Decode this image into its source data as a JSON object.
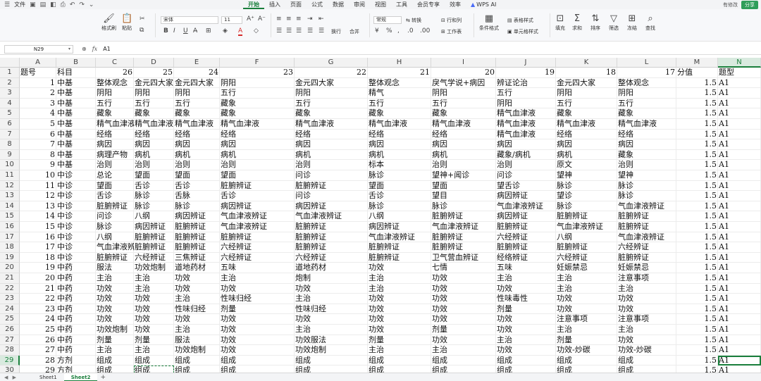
{
  "titlebar": {
    "file_label": "文件",
    "menus": [
      "开始",
      "插入",
      "页面",
      "公式",
      "数据",
      "审阅",
      "视图",
      "工具",
      "会员专享",
      "效率"
    ],
    "active_menu": "开始",
    "wps_ai_label": "WPS AI",
    "modified_label": "有修改",
    "share_label": "分享"
  },
  "ribbon": {
    "format_painter": "格式刷",
    "paste": "粘贴",
    "font_name": "宋体",
    "font_size": "11",
    "number_format": "常规",
    "convert": "转换",
    "wrap": "换行",
    "merge": "合并",
    "rows_cols": "行和列",
    "worksheet": "工作表",
    "cond_format": "条件格式",
    "table_style": "表格样式",
    "cell_style": "单元格样式",
    "fill": "填充",
    "sum": "求和",
    "sort": "排序",
    "filter": "筛选",
    "freeze": "冻结",
    "find": "查找",
    "font_color": "#d62b2b",
    "highlight_color": "#f5d200"
  },
  "formula_bar": {
    "name_box": "N29",
    "fx_label": "fx",
    "value": "A1"
  },
  "grid": {
    "columns": [
      "A",
      "B",
      "C",
      "D",
      "E",
      "F",
      "G",
      "H",
      "I",
      "J",
      "K",
      "L",
      "M",
      "N"
    ],
    "selected_column": "N",
    "row_numbers": [
      1,
      2,
      3,
      4,
      5,
      6,
      7,
      8,
      9,
      10,
      11,
      12,
      13,
      14,
      15,
      16,
      17,
      18,
      19,
      20,
      21,
      22,
      23,
      24,
      25,
      26,
      27,
      28,
      29,
      30
    ],
    "selected_row": 29,
    "header_row": [
      "题号",
      "科目",
      "26",
      "25",
      "24",
      "23",
      "22",
      "21",
      "20",
      "19",
      "18",
      "17",
      "分值",
      "题型"
    ],
    "rows": [
      [
        "1",
        "中基",
        "整体观念",
        "金元四大家",
        "金元四大家",
        "阴阳",
        "金元四大家",
        "整体观念",
        "戾气学说+病因",
        "辨证论治",
        "金元四大家",
        "整体观念",
        "1.5",
        "A1"
      ],
      [
        "2",
        "中基",
        "阴阳",
        "阴阳",
        "阴阳",
        "五行",
        "阴阳",
        "精气",
        "阴阳",
        "五行",
        "阴阳",
        "阴阳",
        "1.5",
        "A1"
      ],
      [
        "3",
        "中基",
        "五行",
        "五行",
        "五行",
        "藏象",
        "五行",
        "五行",
        "五行",
        "阴阳",
        "五行",
        "五行",
        "1.5",
        "A1"
      ],
      [
        "4",
        "中基",
        "藏象",
        "藏象",
        "藏象",
        "藏象",
        "藏象",
        "藏象",
        "藏象",
        "精气血津液",
        "藏象",
        "藏象",
        "1.5",
        "A1"
      ],
      [
        "5",
        "中基",
        "精气血津液",
        "精气血津液",
        "精气血津液",
        "精气血津液",
        "精气血津液",
        "精气血津液",
        "精气血津液",
        "精气血津液",
        "精气血津液",
        "精气血津液",
        "1.5",
        "A1"
      ],
      [
        "6",
        "中基",
        "经络",
        "经络",
        "经络",
        "经络",
        "经络",
        "经络",
        "经络",
        "精气血津液",
        "经络",
        "经络",
        "1.5",
        "A1"
      ],
      [
        "7",
        "中基",
        "病因",
        "病因",
        "病因",
        "病因",
        "病因",
        "病因",
        "病因",
        "病因",
        "病因",
        "病因",
        "1.5",
        "A1"
      ],
      [
        "8",
        "中基",
        "病理产物",
        "病机",
        "病机",
        "病机",
        "病机",
        "病机",
        "病机",
        "藏象/病机",
        "病机",
        "藏象",
        "1.5",
        "A1"
      ],
      [
        "9",
        "中基",
        "治则",
        "治则",
        "治则",
        "治则",
        "治则",
        "标本",
        "治则",
        "治则",
        "原文",
        "治则",
        "1.5",
        "A1"
      ],
      [
        "10",
        "中诊",
        "总论",
        "望面",
        "望面",
        "望面",
        "问诊",
        "脉诊",
        "望神+闻诊",
        "问诊",
        "望神",
        "望神",
        "1.5",
        "A1"
      ],
      [
        "11",
        "中诊",
        "望面",
        "舌诊",
        "舌诊",
        "脏腑辨证",
        "脏腑辨证",
        "望面",
        "望面",
        "望舌诊",
        "脉诊",
        "脉诊",
        "1.5",
        "A1"
      ],
      [
        "12",
        "中诊",
        "舌诊",
        "脉诊",
        "舌脉",
        "舌诊",
        "问诊",
        "舌诊",
        "望目",
        "病因辨证",
        "望诊",
        "脉诊",
        "1.5",
        "A1"
      ],
      [
        "13",
        "中诊",
        "脏腑辨证",
        "脉诊",
        "脉诊",
        "病因辨证",
        "病因辨证",
        "脉诊",
        "脉诊",
        "气血津液辨证",
        "脉诊",
        "气血津液辨证",
        "1.5",
        "A1"
      ],
      [
        "14",
        "中诊",
        "问诊",
        "八纲",
        "病因辨证",
        "气血津液辨证",
        "气血津液辨证",
        "八纲",
        "脏腑辨证",
        "病因辨证",
        "脏腑辨证",
        "脏腑辨证",
        "1.5",
        "A1"
      ],
      [
        "15",
        "中诊",
        "脉诊",
        "病因辨证",
        "脏腑辨证",
        "气血津液辨证",
        "脏腑辨证",
        "病因辨证",
        "气血津液辨证",
        "脏腑辨证",
        "气血津液辨证",
        "脏腑辨证",
        "1.5",
        "A1"
      ],
      [
        "16",
        "中诊",
        "八纲",
        "脏腑辨证",
        "脏腑辨证",
        "脏腑辨证",
        "脏腑辨证",
        "气血津液辨证",
        "脏腑辨证",
        "六经辨证",
        "八纲",
        "气血津液辨证",
        "1.5",
        "A1"
      ],
      [
        "17",
        "中诊",
        "气血津液辨证",
        "脏腑辨证",
        "脏腑辨证",
        "六经辨证",
        "脏腑辨证",
        "脏腑辨证",
        "脏腑辨证",
        "脏腑辨证",
        "脏腑辨证",
        "六经辨证",
        "1.5",
        "A1"
      ],
      [
        "18",
        "中诊",
        "脏腑辨证",
        "六经辨证",
        "三焦辨证",
        "六经辨证",
        "六经辨证",
        "脏腑辨证",
        "卫气营血辨证",
        "经络辨证",
        "六经辨证",
        "脏腑辨证",
        "1.5",
        "A1"
      ],
      [
        "19",
        "中药",
        "服法",
        "功效炮制",
        "道地药材",
        "五味",
        "道地药材",
        "功效",
        "七情",
        "五味",
        "妊娠禁忌",
        "妊娠禁忌",
        "1.5",
        "A1"
      ],
      [
        "20",
        "中药",
        "主治",
        "主治",
        "功效",
        "主治",
        "炮制",
        "主治",
        "功效",
        "主治",
        "主治",
        "注意事项",
        "1.5",
        "A1"
      ],
      [
        "21",
        "中药",
        "功效",
        "主治",
        "功效",
        "功效",
        "功效",
        "主治",
        "功效",
        "功效",
        "主治",
        "主治",
        "1.5",
        "A1"
      ],
      [
        "22",
        "中药",
        "功效",
        "功效",
        "主治",
        "性味归经",
        "主治",
        "功效",
        "功效",
        "性味毒性",
        "功效",
        "功效",
        "1.5",
        "A1"
      ],
      [
        "23",
        "中药",
        "功效",
        "功效",
        "性味归经",
        "剂量",
        "性味归经",
        "功效",
        "功效",
        "剂量",
        "功效",
        "功效",
        "1.5",
        "A1"
      ],
      [
        "24",
        "中药",
        "功效",
        "功效",
        "功效",
        "功效",
        "功效",
        "功效",
        "功效",
        "功效",
        "注意事项",
        "注意事项",
        "1.5",
        "A1"
      ],
      [
        "25",
        "中药",
        "功效炮制",
        "功效",
        "主治",
        "功效",
        "主治",
        "功效",
        "剂量",
        "功效",
        "主治",
        "主治",
        "1.5",
        "A1"
      ],
      [
        "26",
        "中药",
        "剂量",
        "剂量",
        "服法",
        "功效",
        "功效服法",
        "剂量",
        "功效",
        "主治",
        "剂量",
        "功效",
        "1.5",
        "A1"
      ],
      [
        "27",
        "中药",
        "主治",
        "主治",
        "功效炮制",
        "功效",
        "功效炮制",
        "主治",
        "主治",
        "功效",
        "功效-炒碳",
        "功效-炒碳",
        "1.5",
        "A1"
      ],
      [
        "28",
        "方剂",
        "组成",
        "组成",
        "组成",
        "组成",
        "组成",
        "组成",
        "组成",
        "组成",
        "组成",
        "组成",
        "1.5",
        "A1"
      ],
      [
        "29",
        "方剂",
        "组成",
        "组成",
        "组成",
        "组成",
        "组成",
        "组成",
        "组成",
        "组成",
        "组成",
        "组成",
        "1.5",
        "A1"
      ]
    ]
  },
  "sheets": {
    "tabs": [
      "Sheet1",
      "Sheet2"
    ],
    "active": "Sheet2",
    "add_label": "+"
  }
}
